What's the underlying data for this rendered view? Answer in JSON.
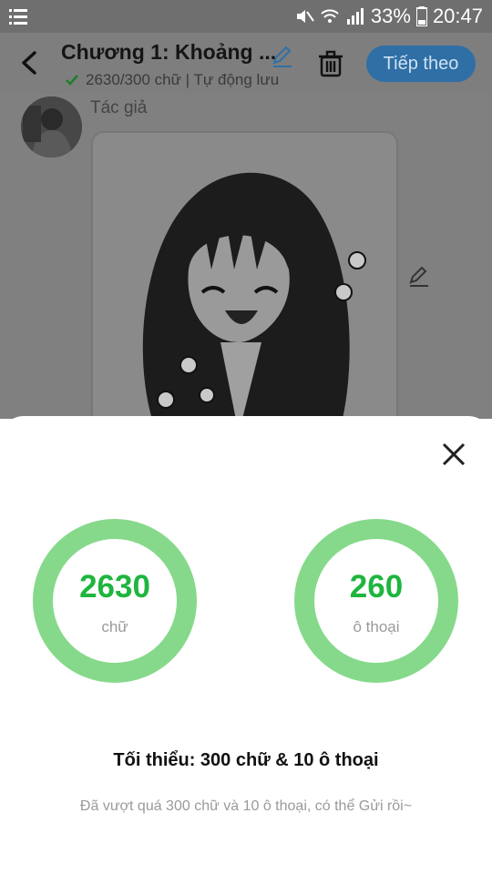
{
  "status_bar": {
    "battery_percent": "33%",
    "time": "20:47",
    "icons": [
      "menu-icon",
      "mute-icon",
      "wifi-icon",
      "signal-icon",
      "battery-icon"
    ]
  },
  "header": {
    "title": "Chương 1: Khoảng ...",
    "subtitle": "2630/300 chữ | Tự động lưu",
    "next_label": "Tiếp theo"
  },
  "content": {
    "author_label": "Tác giả"
  },
  "sheet": {
    "stat1": {
      "value": "2630",
      "label": "chữ"
    },
    "stat2": {
      "value": "260",
      "label": "ô thoại"
    },
    "minimum": "Tối thiểu: 300 chữ & 10 ô thoại",
    "note": "Đã vượt quá 300 chữ và 10 ô thoại, có thể Gửi rồi~"
  },
  "colors": {
    "accent_green": "#1fb53f",
    "ring_green": "#86d98b",
    "button_blue": "#2f6fa6"
  }
}
